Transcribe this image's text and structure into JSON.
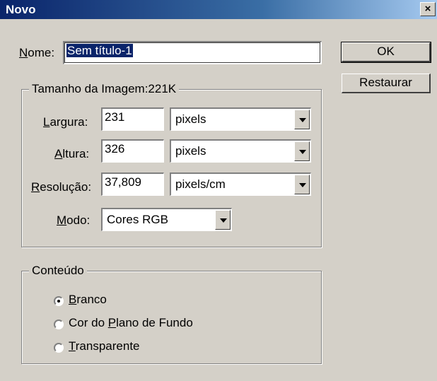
{
  "window": {
    "title": "Novo",
    "close_glyph": "×"
  },
  "name": {
    "label_first": "N",
    "label_rest": "ome:",
    "value": "Sem título-1"
  },
  "buttons": {
    "ok": "OK",
    "reset": "Restaurar"
  },
  "image_size": {
    "legend": "Tamanho da Imagem:221K",
    "width": {
      "label_first": "L",
      "label_rest": "argura:",
      "value": "231",
      "unit": "pixels"
    },
    "height": {
      "label_first": "A",
      "label_rest": "ltura:",
      "value": "326",
      "unit": "pixels"
    },
    "resolution": {
      "label_first": "R",
      "label_rest": "esolução:",
      "value": "37,809",
      "unit": "pixels/cm"
    },
    "mode": {
      "label_first": "M",
      "label_rest": "odo:",
      "value": "Cores RGB"
    }
  },
  "content": {
    "legend": "Conteúdo",
    "options": [
      {
        "label_first": "B",
        "label_rest": "ranco",
        "selected": true
      },
      {
        "label_pre": "Cor do ",
        "label_first": "P",
        "label_rest": "lano de Fundo",
        "selected": false
      },
      {
        "label_first": "T",
        "label_rest": "ransparente",
        "selected": false
      }
    ]
  }
}
